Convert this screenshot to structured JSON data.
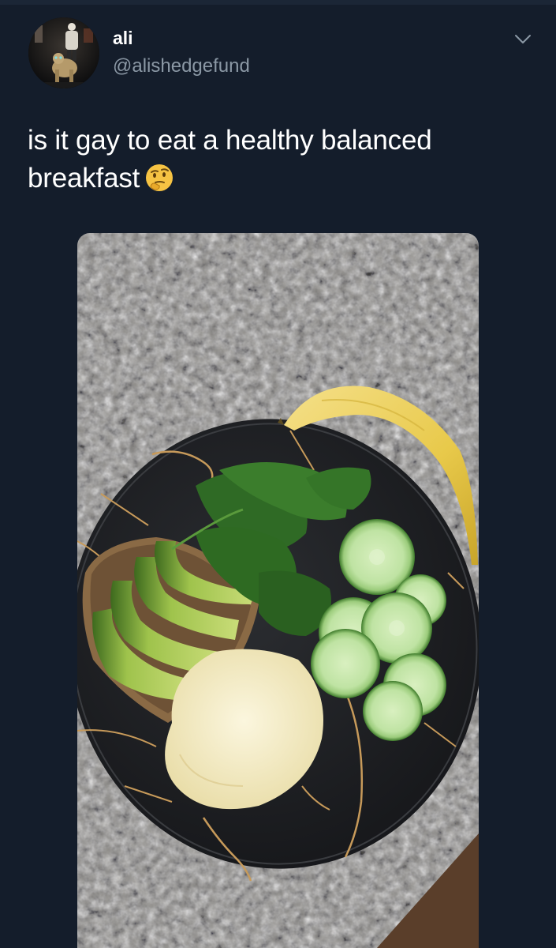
{
  "tweet": {
    "display_name": "ali",
    "handle": "@alishedgefund",
    "text": "is it gay to eat a healthy balanced breakfast",
    "emoji": "thinking-face"
  },
  "icons": {
    "menu": "chevron-down-icon"
  },
  "colors": {
    "background": "#141d2b",
    "secondary_text": "#8b98a5",
    "primary_text": "#ffffff"
  }
}
